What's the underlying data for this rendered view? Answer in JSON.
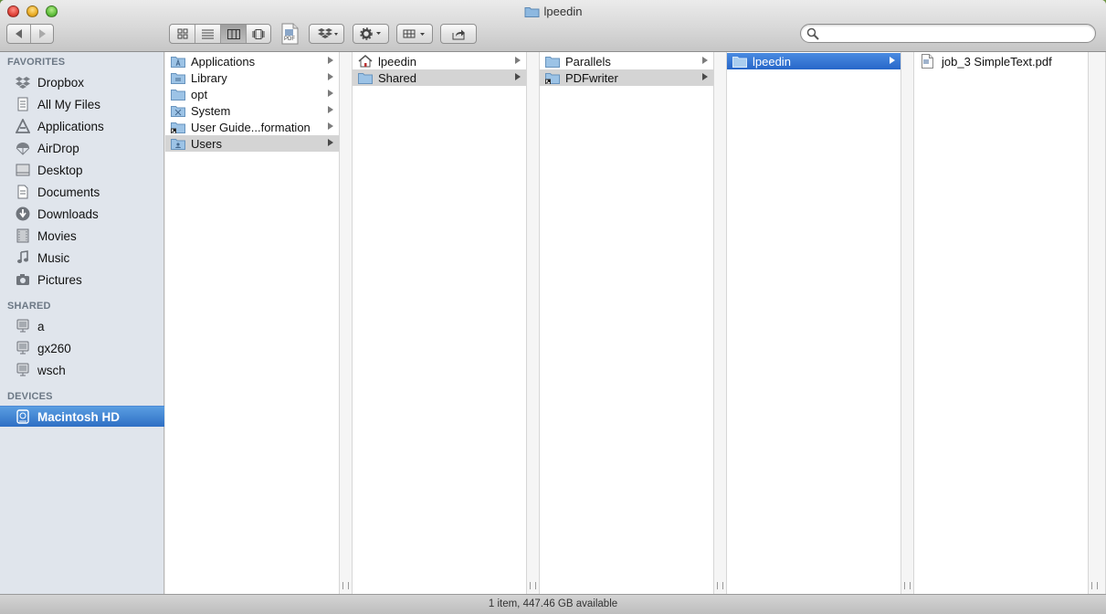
{
  "window": {
    "title": "lpeedin"
  },
  "toolbar": {
    "back_icon": "chevron-left-icon",
    "forward_icon": "chevron-right-icon",
    "views": [
      "icon-view",
      "list-view",
      "column-view",
      "coverflow-view"
    ],
    "active_view": "column-view",
    "pdf_label": "PDF",
    "search": {
      "value": "",
      "placeholder": ""
    }
  },
  "sidebar": {
    "favorites_header": "FAVORITES",
    "favorites": [
      {
        "label": "Dropbox",
        "icon": "dropbox-icon"
      },
      {
        "label": "All My Files",
        "icon": "all-files-icon"
      },
      {
        "label": "Applications",
        "icon": "applications-icon"
      },
      {
        "label": "AirDrop",
        "icon": "airdrop-icon"
      },
      {
        "label": "Desktop",
        "icon": "desktop-icon"
      },
      {
        "label": "Documents",
        "icon": "documents-icon"
      },
      {
        "label": "Downloads",
        "icon": "downloads-icon"
      },
      {
        "label": "Movies",
        "icon": "movies-icon"
      },
      {
        "label": "Music",
        "icon": "music-icon"
      },
      {
        "label": "Pictures",
        "icon": "pictures-icon"
      }
    ],
    "shared_header": "SHARED",
    "shared": [
      {
        "label": "a",
        "icon": "network-computer-icon"
      },
      {
        "label": "gx260",
        "icon": "network-computer-icon"
      },
      {
        "label": "wsch",
        "icon": "network-computer-icon"
      }
    ],
    "devices_header": "DEVICES",
    "devices": [
      {
        "label": "Macintosh HD",
        "icon": "hard-drive-icon",
        "selected": true
      }
    ]
  },
  "columns": [
    {
      "items": [
        {
          "label": "Applications",
          "icon": "folder-icon",
          "arrow": true
        },
        {
          "label": "Library",
          "icon": "folder-icon",
          "arrow": true
        },
        {
          "label": "opt",
          "icon": "folder-icon",
          "arrow": true
        },
        {
          "label": "System",
          "icon": "folder-icon",
          "arrow": true
        },
        {
          "label": "User Guide...formation",
          "icon": "alias-folder-icon",
          "arrow": true
        },
        {
          "label": "Users",
          "icon": "folder-icon",
          "arrow": true,
          "selected": "gray"
        }
      ]
    },
    {
      "items": [
        {
          "label": "lpeedin",
          "icon": "home-icon",
          "arrow": true
        },
        {
          "label": "Shared",
          "icon": "folder-icon",
          "arrow": true,
          "selected": "gray"
        }
      ]
    },
    {
      "items": [
        {
          "label": "Parallels",
          "icon": "folder-icon",
          "arrow": true
        },
        {
          "label": "PDFwriter",
          "icon": "alias-folder-icon",
          "arrow": true,
          "selected": "gray"
        }
      ]
    },
    {
      "items": [
        {
          "label": "lpeedin",
          "icon": "folder-icon",
          "arrow": true,
          "selected": "blue"
        }
      ]
    },
    {
      "items": [
        {
          "label": "job_3 SimpleText.pdf",
          "icon": "pdf-file-icon",
          "arrow": false
        }
      ]
    }
  ],
  "status": {
    "text": "1 item, 447.46 GB available"
  },
  "colors": {
    "selection_blue": "#2e6fc4",
    "selection_gray": "#d4d4d4",
    "sidebar_bg": "#e0e5ec"
  }
}
